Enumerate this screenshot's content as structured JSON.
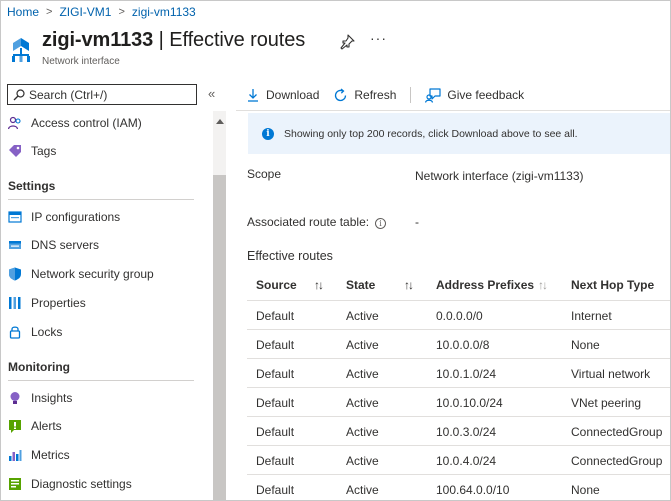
{
  "breadcrumb": [
    "Home",
    "ZIGI-VM1",
    "zigi-vm1133"
  ],
  "header": {
    "resource_name": "zigi-vm1133",
    "divider": "|",
    "blade_title": "Effective routes",
    "subtitle": "Network interface",
    "more": "···"
  },
  "sidebar": {
    "search_placeholder": "Search (Ctrl+/)",
    "collapse": "«",
    "items_top": [
      {
        "label": "Access control (IAM)",
        "icon": "people-icon"
      },
      {
        "label": "Tags",
        "icon": "tag-icon"
      }
    ],
    "sections": [
      {
        "title": "Settings",
        "items": [
          {
            "label": "IP configurations",
            "icon": "ip-config-icon"
          },
          {
            "label": "DNS servers",
            "icon": "dns-icon"
          },
          {
            "label": "Network security group",
            "icon": "shield-icon"
          },
          {
            "label": "Properties",
            "icon": "properties-icon"
          },
          {
            "label": "Locks",
            "icon": "lock-icon"
          }
        ]
      },
      {
        "title": "Monitoring",
        "items": [
          {
            "label": "Insights",
            "icon": "lightbulb-icon"
          },
          {
            "label": "Alerts",
            "icon": "alert-icon"
          },
          {
            "label": "Metrics",
            "icon": "metrics-icon"
          },
          {
            "label": "Diagnostic settings",
            "icon": "diagnostic-icon"
          }
        ]
      }
    ]
  },
  "toolbar": {
    "download": "Download",
    "refresh": "Refresh",
    "feedback": "Give feedback"
  },
  "banner": {
    "info_glyph": "i",
    "text": "Showing only top 200 records, click Download above to see all."
  },
  "properties": {
    "scope_label": "Scope",
    "scope_value": "Network interface (zigi-vm1133)",
    "route_table_label": "Associated route table:",
    "route_table_value": "-",
    "info_glyph": "i"
  },
  "routes": {
    "title": "Effective routes",
    "sort_glyph": "↑↓",
    "columns": [
      "Source",
      "State",
      "Address Prefixes",
      "Next Hop Type"
    ],
    "rows": [
      [
        "Default",
        "Active",
        "0.0.0.0/0",
        "Internet"
      ],
      [
        "Default",
        "Active",
        "10.0.0.0/8",
        "None"
      ],
      [
        "Default",
        "Active",
        "10.0.1.0/24",
        "Virtual network"
      ],
      [
        "Default",
        "Active",
        "10.0.10.0/24",
        "VNet peering"
      ],
      [
        "Default",
        "Active",
        "10.0.3.0/24",
        "ConnectedGroup"
      ],
      [
        "Default",
        "Active",
        "10.0.4.0/24",
        "ConnectedGroup"
      ],
      [
        "Default",
        "Active",
        "100.64.0.0/10",
        "None"
      ]
    ]
  },
  "colors": {
    "link": "#0062ad",
    "accent": "#0078d4",
    "banner_bg": "#ebf3fc"
  }
}
